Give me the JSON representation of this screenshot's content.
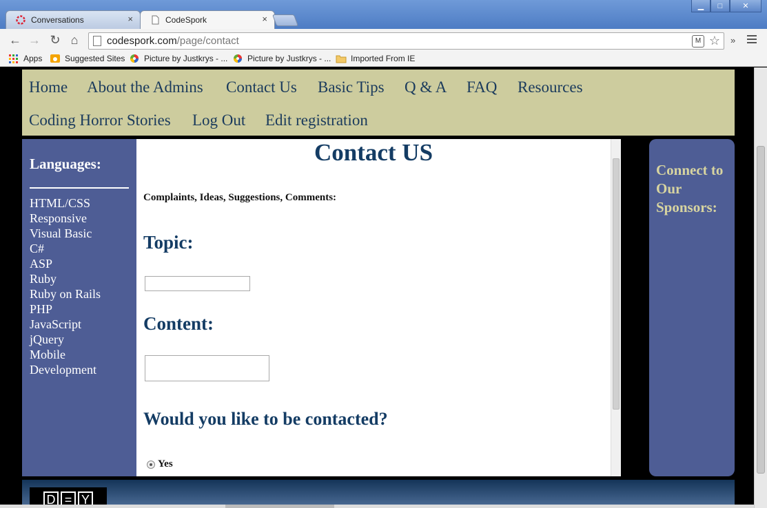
{
  "browser": {
    "tabs": [
      {
        "label": "Conversations",
        "icon": "loading-spinner-icon"
      },
      {
        "label": "CodeSpork",
        "icon": "page-icon"
      }
    ],
    "close_glyph": "×",
    "window_buttons": {
      "minimize": "▁",
      "maximize": "□",
      "close": "✕"
    },
    "address": {
      "domain": "codespork.com",
      "path": "/page/contact"
    },
    "nav": {
      "back": "←",
      "forward": "→",
      "reload": "↻",
      "home": "⌂"
    },
    "star": "☆",
    "extension_label": "M",
    "overflow": "»",
    "bookmarks": [
      {
        "label": "Apps",
        "icon": "apps-grid-icon"
      },
      {
        "label": "Suggested Sites",
        "icon": "suggested-sites-icon"
      },
      {
        "label": "Picture by Justkrys - ...",
        "icon": "picasa-icon"
      },
      {
        "label": "Picture by Justkrys - ...",
        "icon": "picasa-icon"
      },
      {
        "label": "Imported From IE",
        "icon": "folder-icon"
      }
    ]
  },
  "site": {
    "nav": [
      "Home",
      "About the Admins",
      "Contact Us",
      "Basic Tips",
      "Q & A",
      "FAQ",
      "Resources",
      "Coding Horror Stories",
      "Log Out",
      "Edit registration"
    ],
    "left": {
      "heading": "Languages:",
      "items": [
        "HTML/CSS",
        "Responsive",
        "Visual Basic",
        "C#",
        "ASP",
        "Ruby",
        "Ruby on Rails",
        "PHP",
        "JavaScript",
        "jQuery",
        "Mobile",
        "Development"
      ]
    },
    "main": {
      "title": "Contact US",
      "subtitle": "Complaints, Ideas, Suggestions, Comments:",
      "topic_label": "Topic:",
      "topic_value": "",
      "content_label": "Content:",
      "content_value": "",
      "contacted_label": "Would you like to be contacted?",
      "radio_yes": "Yes"
    },
    "right": {
      "heading": "Connect to Our Sponsors:"
    },
    "footer_logo": [
      "D",
      "=",
      "Y"
    ]
  },
  "colors": {
    "nav_bg": "#cdcc9e",
    "sidebar_bg": "#4e5d95",
    "heading_blue": "#143c64",
    "sponsor_text": "#d7d4a0"
  }
}
